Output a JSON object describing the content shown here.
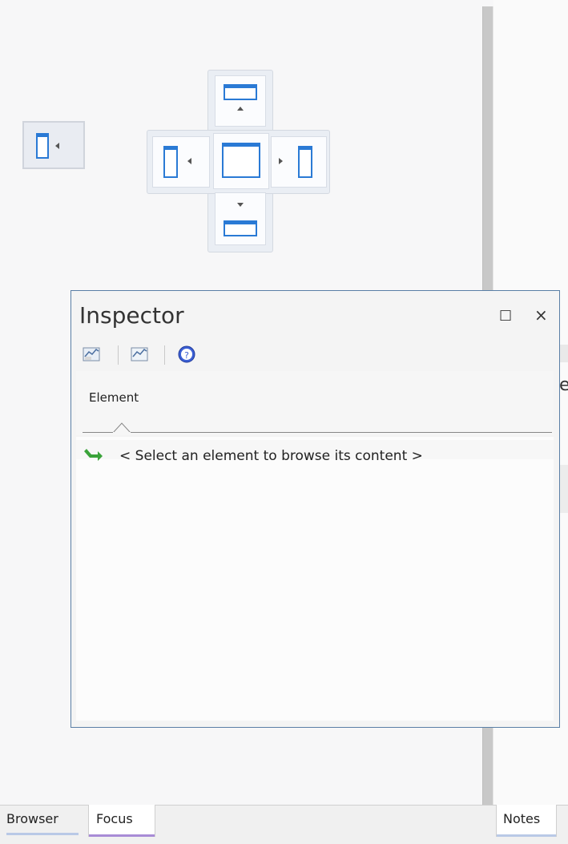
{
  "inspector": {
    "title": "Inspector",
    "maximize_glyph": "□",
    "close_glyph": "×",
    "toolbar": [
      "show-features-icon",
      "show-relationships-icon",
      "help-icon"
    ],
    "tab": "Element",
    "empty_message": "< Select an element to browse its content >",
    "message_icon": "green-arrow-icon"
  },
  "right_panel": {
    "edge_text": "e"
  },
  "bottom_tabs": {
    "left": [
      "Browser",
      "Focus"
    ],
    "right": [
      "Notes"
    ]
  },
  "colors": {
    "accent": "#2a7ad5",
    "focus_underline": "#a88bd6",
    "browser_underline": "#b9c9e6",
    "inspector_border": "#5a7fa6",
    "help_icon": "#3b5fd4",
    "arrow_green": "#3aa33a"
  }
}
